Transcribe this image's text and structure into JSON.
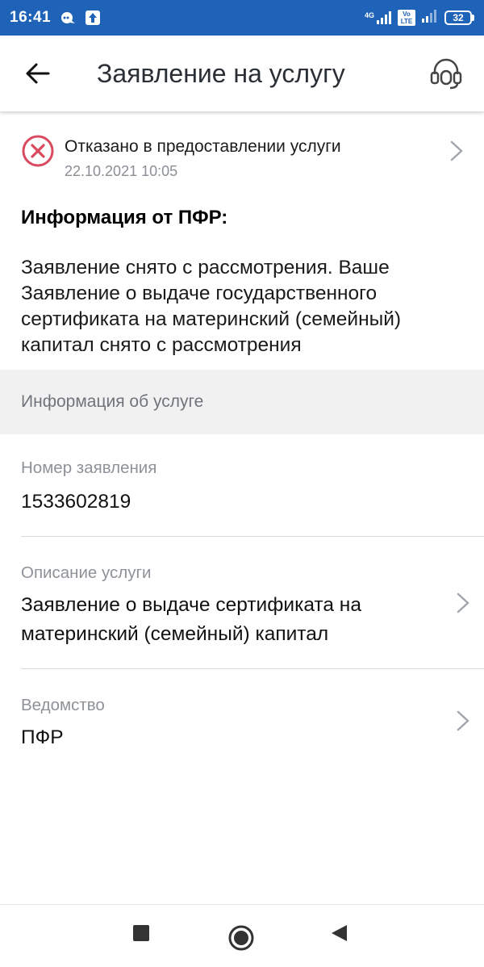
{
  "status_bar": {
    "time": "16:41",
    "network_label": "4G",
    "volte_label": "Vo LTE",
    "battery": "32",
    "colors": {
      "background": "#1e63b8"
    }
  },
  "app_bar": {
    "title": "Заявление на услугу",
    "back_icon": "arrow-left-icon",
    "support_icon": "headset-icon"
  },
  "status": {
    "title": "Отказано в предоставлении услуги",
    "date": "22.10.2021 10:05",
    "icon": "error-circle-icon",
    "color": "#d94a5f"
  },
  "info": {
    "heading": "Информация от ПФР:",
    "text": "Заявление снято с рассмотрения. Ваше Заявление о выдаче государственного сертификата на материнский (семейный) капитал снято с рассмотрения"
  },
  "service_section": {
    "title": "Информация об услуге",
    "fields": [
      {
        "label": "Номер заявления",
        "value": "1533602819"
      },
      {
        "label": "Описание услуги",
        "value": "Заявление о выдаче сертификата на материнский (семейный) капитал"
      },
      {
        "label": "Ведомство",
        "value": "ПФР"
      }
    ]
  },
  "nav_bar": {
    "recents_icon": "square-icon",
    "home_icon": "circle-icon",
    "back_icon": "triangle-back-icon"
  }
}
